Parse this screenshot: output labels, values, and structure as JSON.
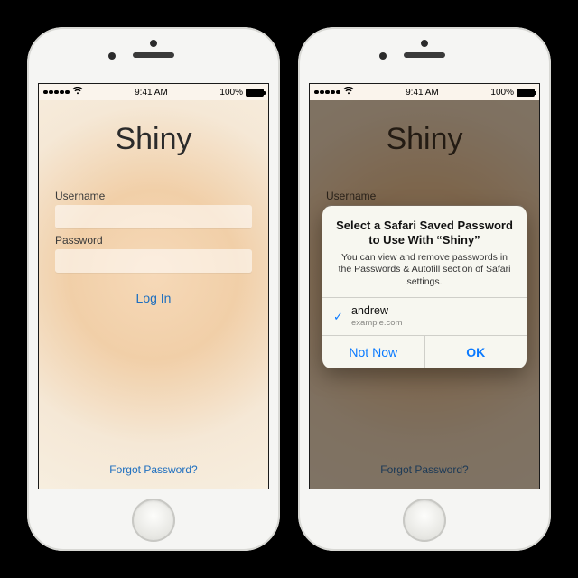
{
  "status": {
    "time": "9:41 AM",
    "battery_pct": "100%"
  },
  "app": {
    "title": "Shiny",
    "username_label": "Username",
    "password_label": "Password",
    "login": "Log In",
    "forgot": "Forgot Password?"
  },
  "alert": {
    "title": "Select a Safari Saved Password to Use With “Shiny”",
    "message": "You can view and remove passwords in the Passwords & Autofill section of Safari settings.",
    "credential": {
      "user": "andrew",
      "domain": "example.com"
    },
    "not_now": "Not Now",
    "ok": "OK"
  }
}
